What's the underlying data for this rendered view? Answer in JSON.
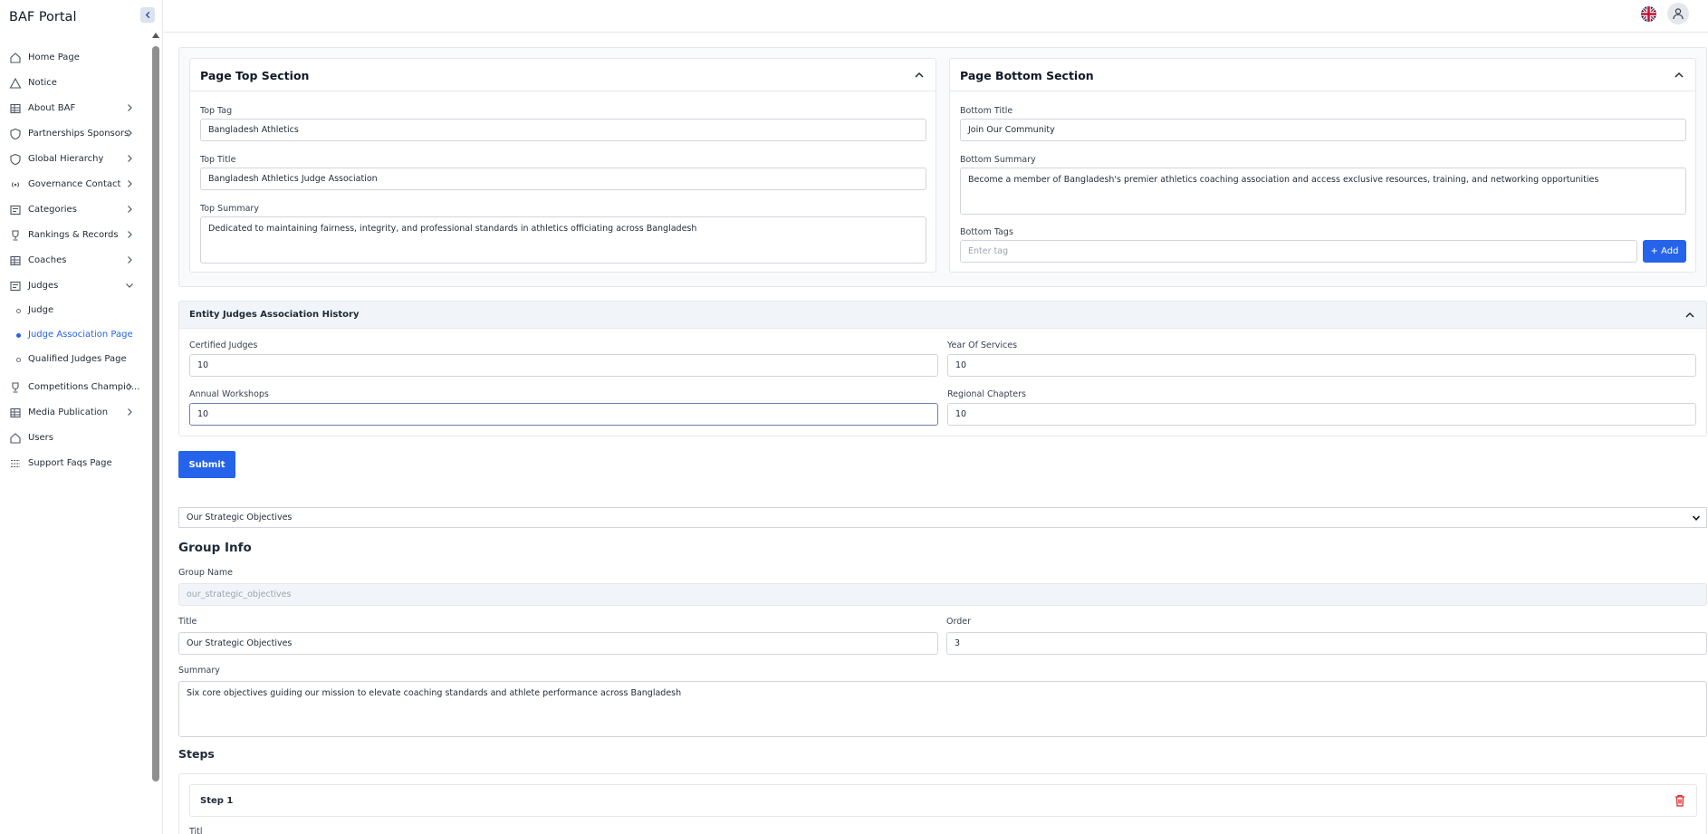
{
  "app": {
    "title": "BAF Portal"
  },
  "sidebar": {
    "items": [
      {
        "label": "Home Page",
        "icon": "home-icon",
        "has_children": false
      },
      {
        "label": "Notice",
        "icon": "alert-triangle-icon",
        "has_children": false
      },
      {
        "label": "About BAF",
        "icon": "grid-icon",
        "has_children": true
      },
      {
        "label": "Partnerships Sponsors",
        "icon": "shield-icon",
        "has_children": true
      },
      {
        "label": "Global Hierarchy",
        "icon": "shield-icon",
        "has_children": true
      },
      {
        "label": "Governance Contact",
        "icon": "broadcast-icon",
        "has_children": true
      },
      {
        "label": "Categories",
        "icon": "list-icon",
        "has_children": true
      },
      {
        "label": "Rankings & Records",
        "icon": "trophy-icon",
        "has_children": true
      },
      {
        "label": "Coaches",
        "icon": "grid-icon",
        "has_children": true
      },
      {
        "label": "Judges",
        "icon": "list-icon",
        "has_children": true,
        "expanded": true
      },
      {
        "label": "Competitions Champio...",
        "icon": "trophy-icon",
        "has_children": true
      },
      {
        "label": "Media Publication",
        "icon": "grid-icon",
        "has_children": true
      },
      {
        "label": "Users",
        "icon": "home-icon",
        "has_children": false
      },
      {
        "label": "Support Faqs Page",
        "icon": "menu-icon",
        "has_children": false
      }
    ],
    "judges_sub": [
      {
        "label": "Judge",
        "active": false
      },
      {
        "label": "Judge Association Page",
        "active": true
      },
      {
        "label": "Qualified Judges Page",
        "active": false
      }
    ]
  },
  "top_section": {
    "title": "Page Top Section",
    "tag_label": "Top Tag",
    "tag_value": "Bangladesh Athletics",
    "title_label": "Top Title",
    "title_value": "Bangladesh Athletics Judge Association",
    "summary_label": "Top Summary",
    "summary_value": "Dedicated to maintaining fairness, integrity, and professional standards in athletics officiating across Bangladesh"
  },
  "bottom_section": {
    "title": "Page Bottom Section",
    "title_label": "Bottom Title",
    "title_value": "Join Our Community",
    "summary_label": "Bottom Summary",
    "summary_value": "Become a member of Bangladesh's premier athletics coaching association and access exclusive resources, training, and networking opportunities",
    "tags_label": "Bottom Tags",
    "tags_placeholder": "Enter tag",
    "add_label": "+ Add"
  },
  "history": {
    "title": "Entity Judges Association History",
    "certified_label": "Certified Judges",
    "certified_value": "10",
    "years_label": "Year Of Services",
    "years_value": "10",
    "workshops_label": "Annual Workshops",
    "workshops_value": "10",
    "chapters_label": "Regional Chapters",
    "chapters_value": "10"
  },
  "submit_label": "Submit",
  "group_select": {
    "selected": "Our Strategic Objectives"
  },
  "group_info": {
    "heading": "Group Info",
    "name_label": "Group Name",
    "name_value": "our_strategic_objectives",
    "title_label": "Title",
    "title_value": "Our Strategic Objectives",
    "order_label": "Order",
    "order_value": "3",
    "summary_label": "Summary",
    "summary_value": "Six core objectives guiding our mission to elevate coaching standards and athlete performance across Bangladesh"
  },
  "steps": {
    "heading": "Steps",
    "items": [
      {
        "title": "Step 1"
      }
    ],
    "peek_label": "Titl"
  },
  "colors": {
    "accent": "#2563eb",
    "danger": "#dc2626"
  }
}
